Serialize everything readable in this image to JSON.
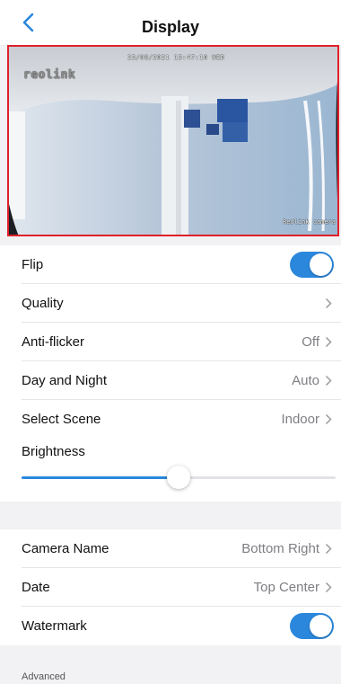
{
  "nav": {
    "title": "Display"
  },
  "preview": {
    "timestamp": "25/08/2021 15:47:10 WED",
    "camera_osd_name": "Reolink camera",
    "logo_text": "reolink"
  },
  "settings": {
    "flip": {
      "label": "Flip",
      "on": true
    },
    "quality": {
      "label": "Quality"
    },
    "anti_flicker": {
      "label": "Anti-flicker",
      "value": "Off"
    },
    "day_night": {
      "label": "Day and Night",
      "value": "Auto"
    },
    "scene": {
      "label": "Select Scene",
      "value": "Indoor"
    },
    "brightness": {
      "label": "Brightness",
      "level": 0.5
    }
  },
  "osd": {
    "camera_name": {
      "label": "Camera Name",
      "value": "Bottom Right"
    },
    "date": {
      "label": "Date",
      "value": "Top Center"
    },
    "watermark": {
      "label": "Watermark",
      "on": true
    }
  },
  "advanced": {
    "header": "Advanced"
  },
  "colors": {
    "accent": "#2b87dc",
    "preview_border": "#e0202a"
  }
}
